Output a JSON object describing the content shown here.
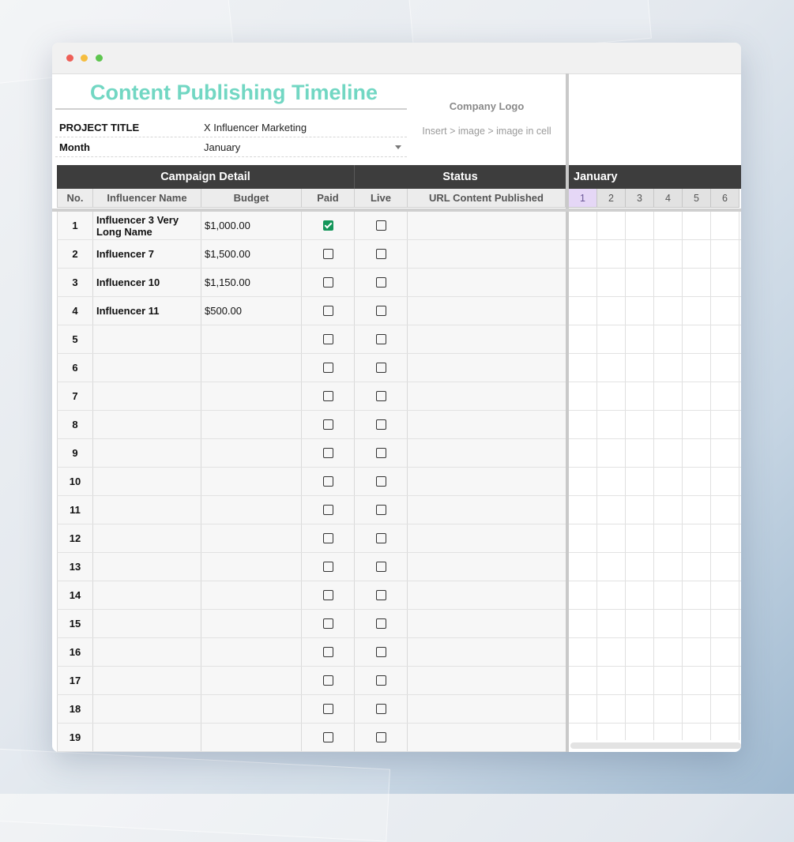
{
  "window": {
    "title_dots": [
      "close",
      "minimize",
      "maximize"
    ]
  },
  "sheet": {
    "title": "Content Publishing Timeline",
    "project_label": "PROJECT TITLE",
    "project_value": "X Influencer Marketing",
    "month_label": "Month",
    "month_value": "January",
    "logo_title": "Company Logo",
    "logo_hint": "Insert > image > image in cell"
  },
  "headers": {
    "group_campaign": "Campaign Detail",
    "group_status": "Status",
    "month": "January",
    "columns": {
      "no": "No.",
      "name": "Influencer Name",
      "budget": "Budget",
      "paid": "Paid",
      "live": "Live",
      "url": "URL Content Published"
    },
    "days": [
      "1",
      "2",
      "3",
      "4",
      "5",
      "6"
    ]
  },
  "rows": [
    {
      "no": "1",
      "name": "Influencer 3 Very Long Name",
      "budget": "$1,000.00",
      "paid": true,
      "live": false,
      "url": ""
    },
    {
      "no": "2",
      "name": "Influencer 7",
      "budget": "$1,500.00",
      "paid": false,
      "live": false,
      "url": ""
    },
    {
      "no": "3",
      "name": "Influencer 10",
      "budget": "$1,150.00",
      "paid": false,
      "live": false,
      "url": ""
    },
    {
      "no": "4",
      "name": "Influencer 11",
      "budget": "$500.00",
      "paid": false,
      "live": false,
      "url": ""
    },
    {
      "no": "5",
      "name": "",
      "budget": "",
      "paid": false,
      "live": false,
      "url": ""
    },
    {
      "no": "6",
      "name": "",
      "budget": "",
      "paid": false,
      "live": false,
      "url": ""
    },
    {
      "no": "7",
      "name": "",
      "budget": "",
      "paid": false,
      "live": false,
      "url": ""
    },
    {
      "no": "8",
      "name": "",
      "budget": "",
      "paid": false,
      "live": false,
      "url": ""
    },
    {
      "no": "9",
      "name": "",
      "budget": "",
      "paid": false,
      "live": false,
      "url": ""
    },
    {
      "no": "10",
      "name": "",
      "budget": "",
      "paid": false,
      "live": false,
      "url": ""
    },
    {
      "no": "11",
      "name": "",
      "budget": "",
      "paid": false,
      "live": false,
      "url": ""
    },
    {
      "no": "12",
      "name": "",
      "budget": "",
      "paid": false,
      "live": false,
      "url": ""
    },
    {
      "no": "13",
      "name": "",
      "budget": "",
      "paid": false,
      "live": false,
      "url": ""
    },
    {
      "no": "14",
      "name": "",
      "budget": "",
      "paid": false,
      "live": false,
      "url": ""
    },
    {
      "no": "15",
      "name": "",
      "budget": "",
      "paid": false,
      "live": false,
      "url": ""
    },
    {
      "no": "16",
      "name": "",
      "budget": "",
      "paid": false,
      "live": false,
      "url": ""
    },
    {
      "no": "17",
      "name": "",
      "budget": "",
      "paid": false,
      "live": false,
      "url": ""
    },
    {
      "no": "18",
      "name": "",
      "budget": "",
      "paid": false,
      "live": false,
      "url": ""
    },
    {
      "no": "19",
      "name": "",
      "budget": "",
      "paid": false,
      "live": false,
      "url": ""
    }
  ],
  "colors": {
    "title_accent": "#72d7c3",
    "header_dark": "#3d3d3d",
    "checked_green": "#14965a",
    "today_highlight": "#e5d7f6"
  }
}
